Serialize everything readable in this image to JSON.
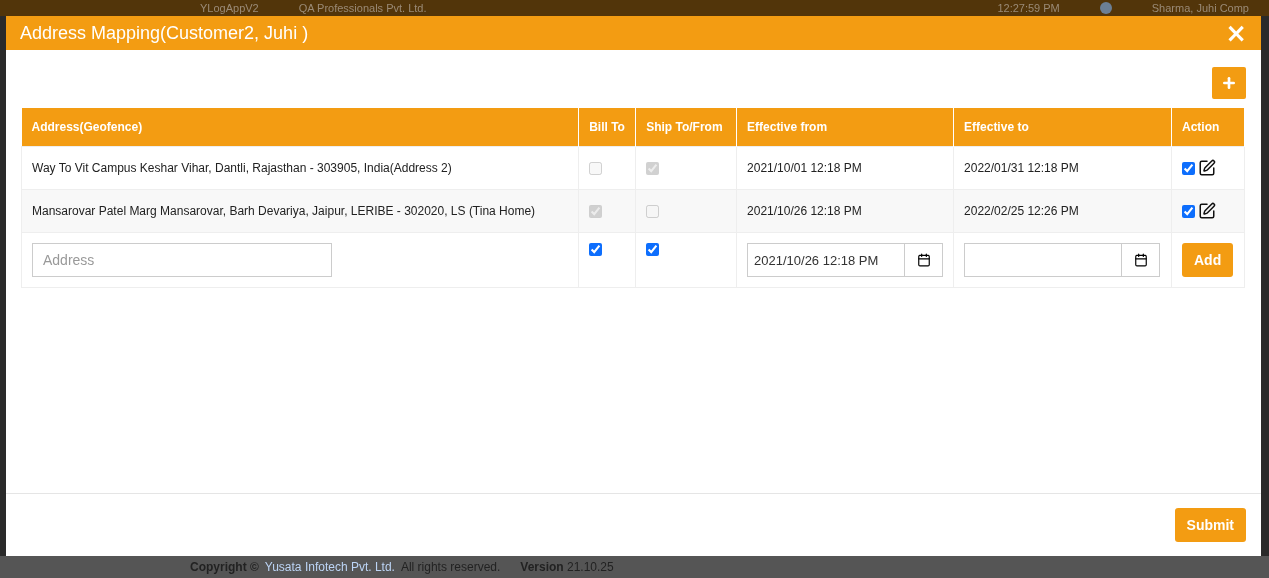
{
  "background": {
    "app_title": "YLogAppV2",
    "company": "QA Professionals Pvt. Ltd.",
    "clock": "12:27:59 PM",
    "user": "Sharma, Juhi Comp",
    "copyright": "Copyright ©",
    "copyright_link": "Yusata Infotech Pvt. Ltd.",
    "rights": "All rights reserved.",
    "version": "**Version** 21.10.25"
  },
  "dialog": {
    "title": "Address Mapping(Customer2, Juhi )",
    "close": "×"
  },
  "table": {
    "columns": [
      "Address(Geofence)",
      "Bill To",
      "Ship To/From",
      "Effective from",
      "Effective to",
      "Action"
    ],
    "rows": [
      {
        "address": "Way To Vit Campus Keshar Vihar, Dantli, Rajasthan - 303905, India(Address 2)",
        "bill_to": {
          "checked": false,
          "disabled": true
        },
        "ship_to": {
          "checked": true,
          "disabled": true
        },
        "effective_from": "2021/10/01 12:18 PM",
        "effective_to": "2022/01/31 12:18 PM",
        "active": {
          "checked": true
        }
      },
      {
        "address": "Mansarovar Patel Marg Mansarovar, Barh Devariya, Jaipur, LERIBE - 302020, LS (Tina Home)",
        "bill_to": {
          "checked": true,
          "disabled": true
        },
        "ship_to": {
          "checked": false,
          "disabled": true
        },
        "effective_from": "2021/10/26 12:18 PM",
        "effective_to": "2022/02/25 12:26 PM",
        "active": {
          "checked": true
        }
      }
    ],
    "new_row": {
      "address": {
        "placeholder": "Address"
      },
      "bill_to": {
        "checked": true,
        "disabled": false
      },
      "ship_to": {
        "checked": true,
        "disabled": false
      },
      "effective_from": {
        "value": "2021/10/26 12:18 PM"
      },
      "add_button": "Add"
    }
  },
  "submit_button": "Submit"
}
